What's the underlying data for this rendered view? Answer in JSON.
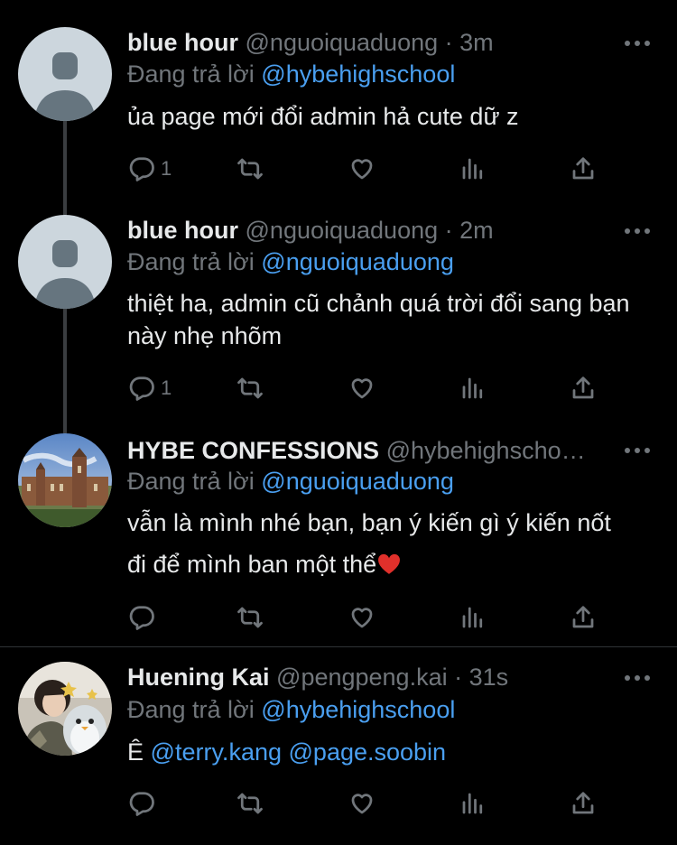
{
  "colors": {
    "background": "#000000",
    "text": "#e7e9ea",
    "muted": "#71767b",
    "link": "#4a9ff0",
    "heart": "#e0302b"
  },
  "tweets": [
    {
      "name": "blue hour",
      "handle": "@nguoiquaduong",
      "time": "3m",
      "replying_label": "Đang trả lời",
      "replying_to": "@hybehighschool",
      "text": "ủa page mới đổi admin hả cute dữ z",
      "reply_count": "1",
      "avatar": "default-avatar"
    },
    {
      "name": "blue hour",
      "handle": "@nguoiquaduong",
      "time": "2m",
      "replying_label": "Đang trả lời",
      "replying_to": "@nguoiquaduong",
      "text": "thiệt ha, admin cũ chảnh quá trời đổi sang bạn này nhẹ nhõm",
      "reply_count": "1",
      "avatar": "default-avatar"
    },
    {
      "name": "HYBE CONFESSIONS",
      "handle": "@hybehighscho…",
      "time": "",
      "replying_label": "Đang trả lời",
      "replying_to": "@nguoiquaduong",
      "text_line1": "vẫn là mình nhé bạn, bạn ý kiến gì ý kiến nốt",
      "text_line2": "đi để mình ban một thể",
      "emoji": "heart-emoji",
      "reply_count": "",
      "avatar": "castle-photo-avatar"
    },
    {
      "name": "Huening Kai",
      "handle": "@pengpeng.kai",
      "time": "31s",
      "replying_label": "Đang trả lời",
      "replying_to": "@hybehighschool",
      "text_prefix": "Ê",
      "mention1": "@terry.kang",
      "mention2": "@page.soobin",
      "reply_count": "",
      "avatar": "person-penguin-photo-avatar"
    }
  ],
  "separator": "·"
}
